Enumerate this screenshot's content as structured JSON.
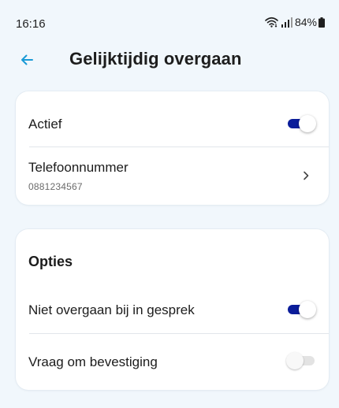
{
  "status_bar": {
    "time": "16:16",
    "battery": "84%",
    "icons": [
      "wifi-icon",
      "signal-icon",
      "battery-icon"
    ]
  },
  "app_bar": {
    "title": "Gelijktijdig overgaan",
    "back_icon": "arrow-left-icon",
    "accent_color": "#1a9ad6"
  },
  "card1": {
    "active_row": {
      "label": "Actief",
      "toggle_on": true
    },
    "phone_row": {
      "label": "Telefoonnummer",
      "value": "0881234567",
      "icon": "chevron-right-icon"
    }
  },
  "options": {
    "title": "Opties",
    "items": [
      {
        "label": "Niet overgaan bij in gesprek",
        "toggle_on": true
      },
      {
        "label": "Vraag om bevestiging",
        "toggle_on": false
      }
    ]
  },
  "colors": {
    "background": "#f1f7fc",
    "toggle_on": "#0b1d9a",
    "toggle_off": "#e3e3e3"
  }
}
